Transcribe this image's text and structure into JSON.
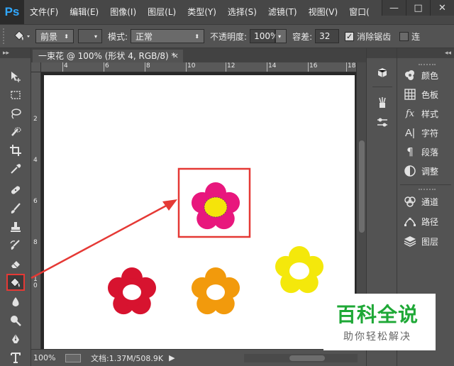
{
  "app": {
    "logo": "Ps"
  },
  "menu": [
    "文件(F)",
    "编辑(E)",
    "图像(I)",
    "图层(L)",
    "类型(Y)",
    "选择(S)",
    "滤镜(T)",
    "视图(V)",
    "窗口("
  ],
  "window_controls": {
    "minimize": "—",
    "restore": "□",
    "close": "✕"
  },
  "options": {
    "fill_source": "前景",
    "mode_label": "模式:",
    "mode_value": "正常",
    "opacity_label": "不透明度:",
    "opacity_value": "100%",
    "tolerance_label": "容差:",
    "tolerance_value": "32",
    "antialias_label": "消除锯齿",
    "antialias_checked": true,
    "contiguous_label": "连"
  },
  "document": {
    "tab_title": "一束花 @ 100% (形状 4, RGB/8) *",
    "close": "×",
    "ruler_top_labels": [
      "4",
      "6",
      "8",
      "10",
      "12",
      "14",
      "16",
      "18"
    ],
    "ruler_left_labels": [
      "2",
      "4",
      "6",
      "8",
      "1\n0"
    ]
  },
  "status": {
    "zoom": "100%",
    "doc_info": "文档:1.37M/508.9K",
    "arrow": "▶"
  },
  "tools": [
    "move-icon",
    "marquee-icon",
    "lasso-icon",
    "quick-select-icon",
    "crop-icon",
    "eyedropper-icon",
    "healing-brush-icon",
    "brush-icon",
    "stamp-icon",
    "history-brush-icon",
    "eraser-icon",
    "paint-bucket-icon",
    "blur-icon",
    "dodge-icon",
    "pen-icon",
    "type-icon"
  ],
  "active_tool": "paint-bucket-icon",
  "panels": [
    {
      "icon": "color-icon",
      "label": "颜色"
    },
    {
      "icon": "swatches-icon",
      "label": "色板"
    },
    {
      "icon": "styles-icon",
      "label": "样式"
    },
    {
      "icon": "character-icon",
      "label": "字符"
    },
    {
      "icon": "paragraph-icon",
      "label": "段落"
    },
    {
      "icon": "adjustments-icon",
      "label": "调整"
    },
    {
      "icon": "channels-icon",
      "label": "通道"
    },
    {
      "icon": "paths-icon",
      "label": "路径"
    },
    {
      "icon": "layers-icon",
      "label": "图层"
    }
  ],
  "canvas": {
    "flowers": [
      {
        "petal_color": "#e8177d",
        "center_color": "#f5e40a"
      },
      {
        "petal_color": "#d7132f",
        "center_color": "#ffffff"
      },
      {
        "petal_color": "#f29a0c",
        "center_color": "#ffffff"
      },
      {
        "petal_color": "#f4e80b",
        "center_color": "#ffffff"
      }
    ],
    "annotation_color": "#e53935"
  },
  "watermark": {
    "title": "百科全说",
    "subtitle": "助你轻松解决",
    "color": "#1ea836"
  }
}
